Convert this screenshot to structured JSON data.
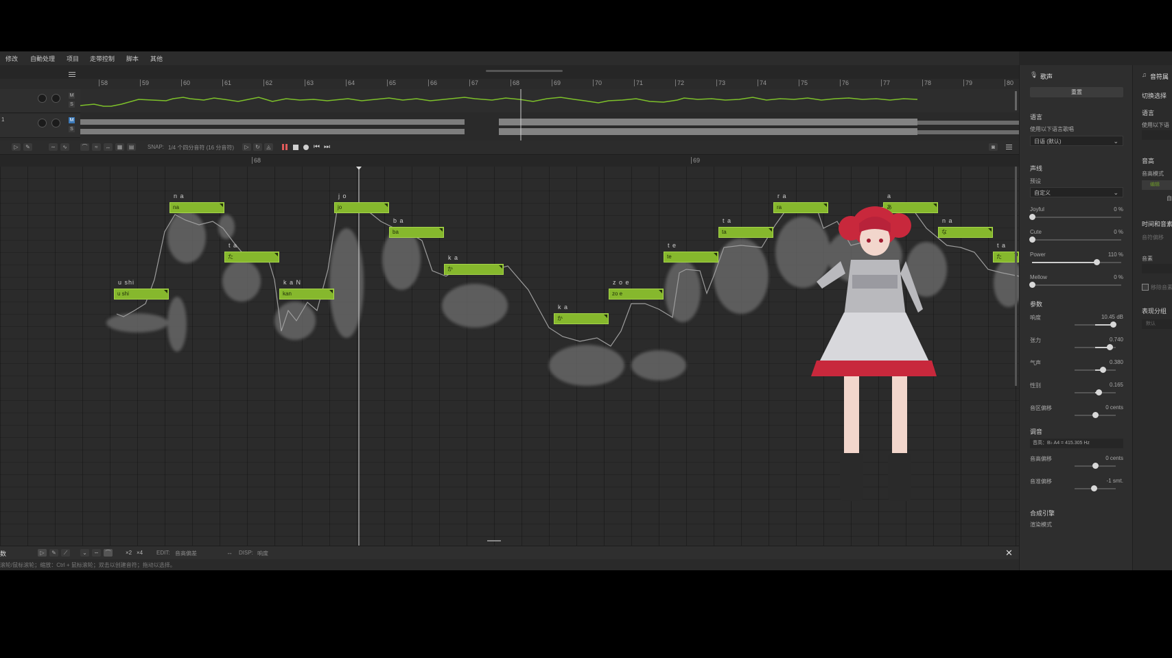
{
  "menu": [
    "修改",
    "自動处理",
    "项目",
    "走带控制",
    "脚本",
    "其他"
  ],
  "ruler": {
    "bars": [
      "58",
      "59",
      "60",
      "61",
      "62",
      "63",
      "64",
      "65",
      "66",
      "67",
      "68",
      "69",
      "70",
      "71",
      "72",
      "73",
      "74",
      "75",
      "76",
      "77",
      "78",
      "79",
      "80"
    ]
  },
  "tracks": [
    {
      "short": "",
      "m": "M",
      "s": "S"
    },
    {
      "short": "1",
      "m": "M",
      "s": "S"
    }
  ],
  "toolbar": {
    "snap_label": "SNAP:",
    "snap_value": "1/4 个四分音符 (16 分音符)"
  },
  "roll_ruler": {
    "bars": [
      "68",
      "69"
    ]
  },
  "notes": [
    {
      "phoneme": "u shi",
      "lyric": "u shi"
    },
    {
      "phoneme": "n a",
      "lyric": "na"
    },
    {
      "phoneme": "t a",
      "lyric": "た"
    },
    {
      "phoneme": "k a N",
      "lyric": "kan"
    },
    {
      "phoneme": "j o",
      "lyric": "jo"
    },
    {
      "phoneme": "b a",
      "lyric": "ba"
    },
    {
      "phoneme": "k a",
      "lyric": "か"
    },
    {
      "phoneme": "k a",
      "lyric": "か"
    },
    {
      "phoneme": "z o e",
      "lyric": "zo e"
    },
    {
      "phoneme": "t e",
      "lyric": "te"
    },
    {
      "phoneme": "t a",
      "lyric": "ta"
    },
    {
      "phoneme": "r a",
      "lyric": "ra"
    },
    {
      "phoneme": "a",
      "lyric": "あ"
    },
    {
      "phoneme": "n a",
      "lyric": "な"
    },
    {
      "phoneme": "t a",
      "lyric": "た"
    }
  ],
  "bottombar": {
    "left_label": "数",
    "edit_label": "EDIT:",
    "edit_value": "音高偏差",
    "disp_label": "DISP:",
    "disp_value": "响度",
    "x2": "×2",
    "x4": "×4"
  },
  "status": "滚轮/鼠标滚轮；缩放：Ctrl + 鼠标滚轮；双击以创建音符；拖动以选择。",
  "panel": {
    "header": "歌声",
    "header_button": "重置",
    "language_title": "语言",
    "language_hint": "使用以下语言歌唱",
    "language_value": "日语 (默认)",
    "voice_title": "声线",
    "preset_label": "预设",
    "preset_value": "自定义",
    "voice_params": [
      {
        "name": "Joyful",
        "value": "0 %",
        "level": 0.0
      },
      {
        "name": "Cute",
        "value": "0 %",
        "level": 0.0
      },
      {
        "name": "Power",
        "value": "110 %",
        "level": 0.72
      },
      {
        "name": "Mellow",
        "value": "0 %",
        "level": 0.0
      }
    ],
    "params_title": "参数",
    "params": [
      {
        "name": "响度",
        "value": "10.45 dB",
        "level": 0.85
      },
      {
        "name": "张力",
        "value": "0.740",
        "level": 0.71
      },
      {
        "name": "气声",
        "value": "0.380",
        "level": 0.36
      },
      {
        "name": "性别",
        "value": "0.165",
        "level": 0.16
      },
      {
        "name": "音区偏移",
        "value": "0 cents",
        "level": 0.0
      }
    ],
    "tuning_title": "调音",
    "tuning_value": "音高：B♭ A4 = 415.305 Hz",
    "tuning_params": [
      {
        "name": "音高偏移",
        "value": "0 cents",
        "level": 0.0
      },
      {
        "name": "音准偏移",
        "value": "-1 smt.",
        "level": -0.08
      }
    ],
    "engine_title": "合成引擎",
    "engine_sub": "渲染模式"
  },
  "panel2": {
    "header": "音符属",
    "switch_label": "切换选择",
    "language_title": "语言",
    "language_hint": "使用以下语",
    "pitch_title": "音高",
    "pitch_mode": "音高模式",
    "pitch_btn": "编辑",
    "auto_label": "自",
    "timing_title": "时间和音素",
    "offset_label": "音符偏移",
    "phoneme_label": "音素",
    "checkbox_label": "移除音素",
    "group_title": "表现分组",
    "group_value": "默认"
  },
  "colors": {
    "note": "#86b82d",
    "pitch": "#7ec22a",
    "background": "#262626"
  }
}
